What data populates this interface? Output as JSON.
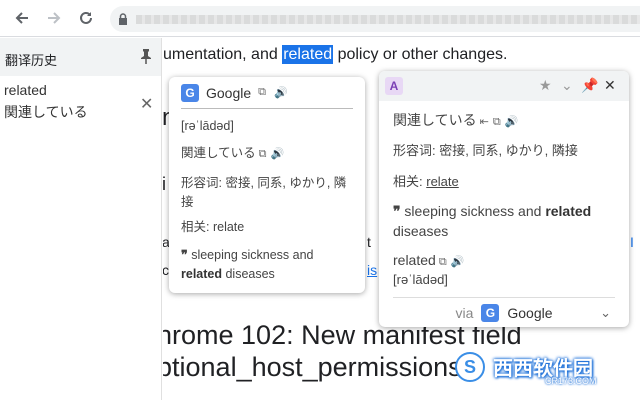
{
  "toolbar": {
    "back_icon": "arrow-left-icon",
    "forward_icon": "arrow-right-icon",
    "reload_icon": "reload-icon",
    "lock_icon": "lock-icon"
  },
  "sidebar": {
    "title": "翻译历史",
    "items": [
      {
        "word": "related",
        "translation": "関連している"
      }
    ],
    "close_glyph": "✕"
  },
  "page": {
    "line1_pre": "umentation, and ",
    "line1_highlight": "related",
    "line1_post": " policy or other changes.",
    "heading_line1": "hrome 102: New manifest field",
    "heading_line2": "ptional_host_permissions"
  },
  "google_popup": {
    "name": "Google",
    "phonetic": "[rəˈlādəd]",
    "translation": "関連している",
    "adjective": "形容词: 密接, 同系, ゆかり, 隣接",
    "related_label": "相关: ",
    "related_word": "relate",
    "example_pre": " sleeping sickness and ",
    "example_bold": "related",
    "example_post": " diseases"
  },
  "translator_popup": {
    "translation": "関連している",
    "adjective": "形容词: 密接, 同系, ゆかり, 隣接",
    "related_label": "相关: ",
    "related_word": "relate",
    "example_pre": " sleeping sickness and ",
    "example_bold": "related",
    "example_post": " diseases",
    "word": "related",
    "phonetic": "[rəˈlādəd]",
    "via": "via",
    "engine": "Google"
  },
  "watermark": {
    "brand": "西西软件园",
    "domain": "CR173.COM"
  }
}
